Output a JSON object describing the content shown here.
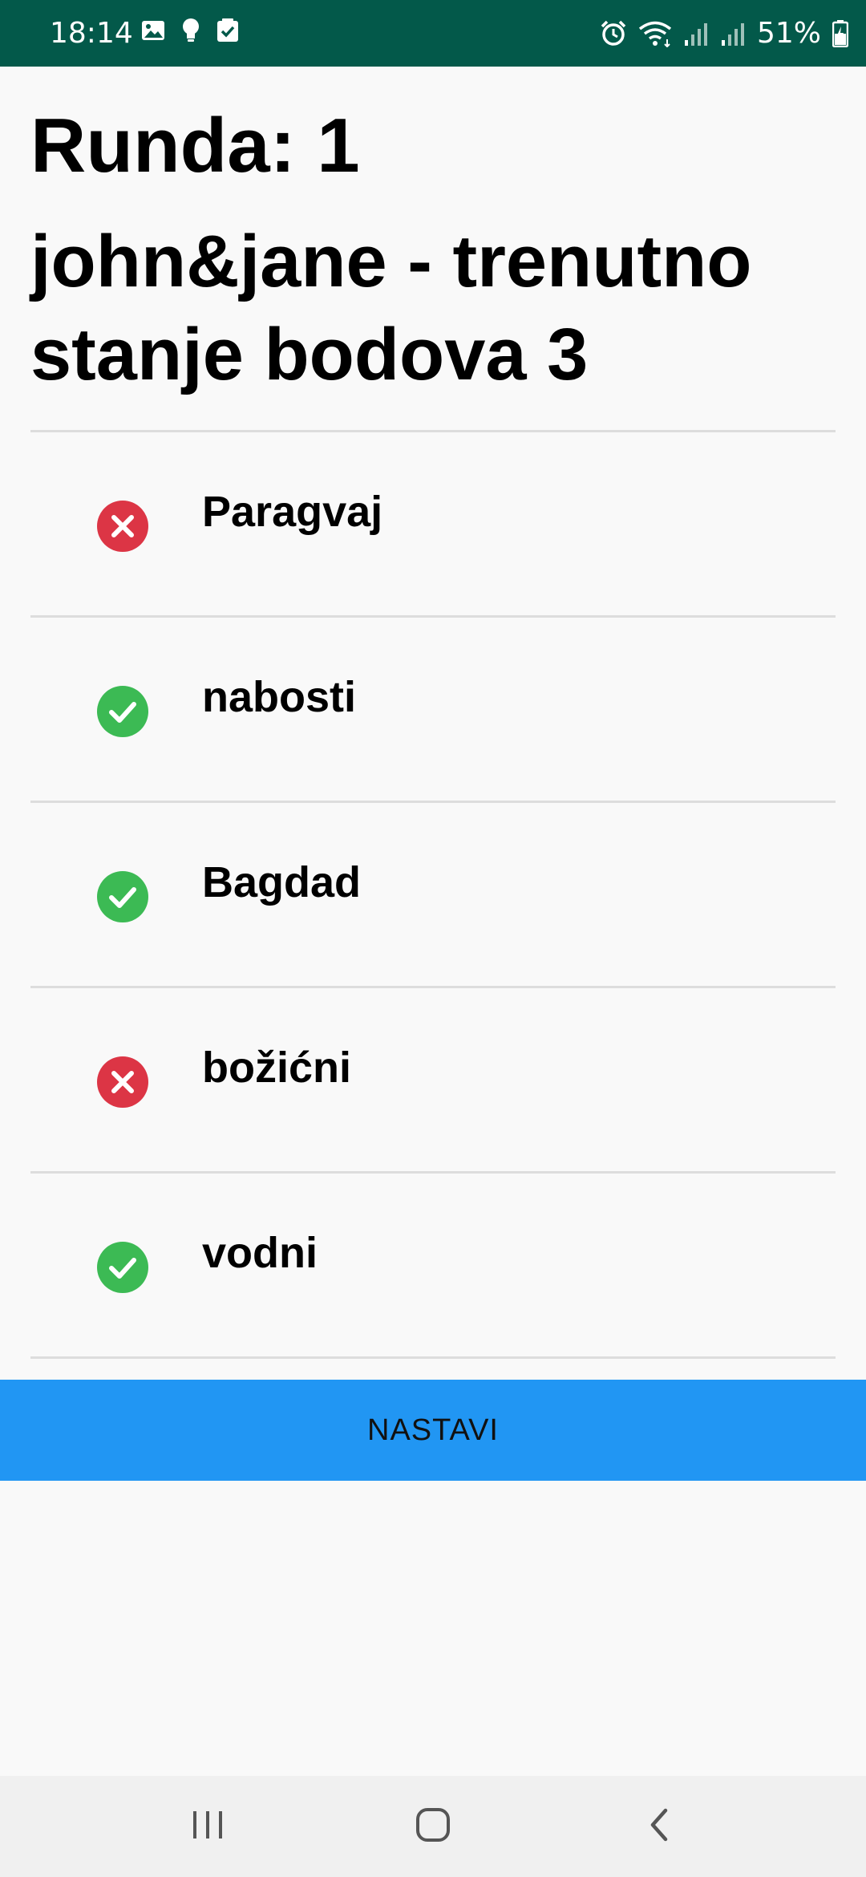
{
  "status_bar": {
    "time": "18:14",
    "battery": "51%",
    "bg_color": "#03594a",
    "left_icons": [
      "gallery-icon",
      "bulb-icon",
      "checkbox-icon"
    ],
    "right_icons": [
      "alarm-icon",
      "wifi-icon",
      "signal-icon",
      "signal-icon",
      "battery-icon"
    ]
  },
  "header": {
    "round_label": "Runda: 1",
    "score_label": "john&jane - trenutno stanje bodova 3"
  },
  "answers": [
    {
      "text": "Paragvaj",
      "correct": false,
      "icon": "error-icon"
    },
    {
      "text": "nabosti",
      "correct": true,
      "icon": "check-icon"
    },
    {
      "text": "Bagdad",
      "correct": true,
      "icon": "check-icon"
    },
    {
      "text": "božićni",
      "correct": false,
      "icon": "error-icon"
    },
    {
      "text": "vodni",
      "correct": true,
      "icon": "check-icon"
    }
  ],
  "colors": {
    "correct": "#3cba54",
    "wrong": "#dc3545",
    "button": "#2196f3"
  },
  "continue_button": {
    "label": "NASTAVI"
  },
  "nav_bar": {
    "buttons": [
      "recents-icon",
      "home-icon",
      "back-icon"
    ]
  }
}
